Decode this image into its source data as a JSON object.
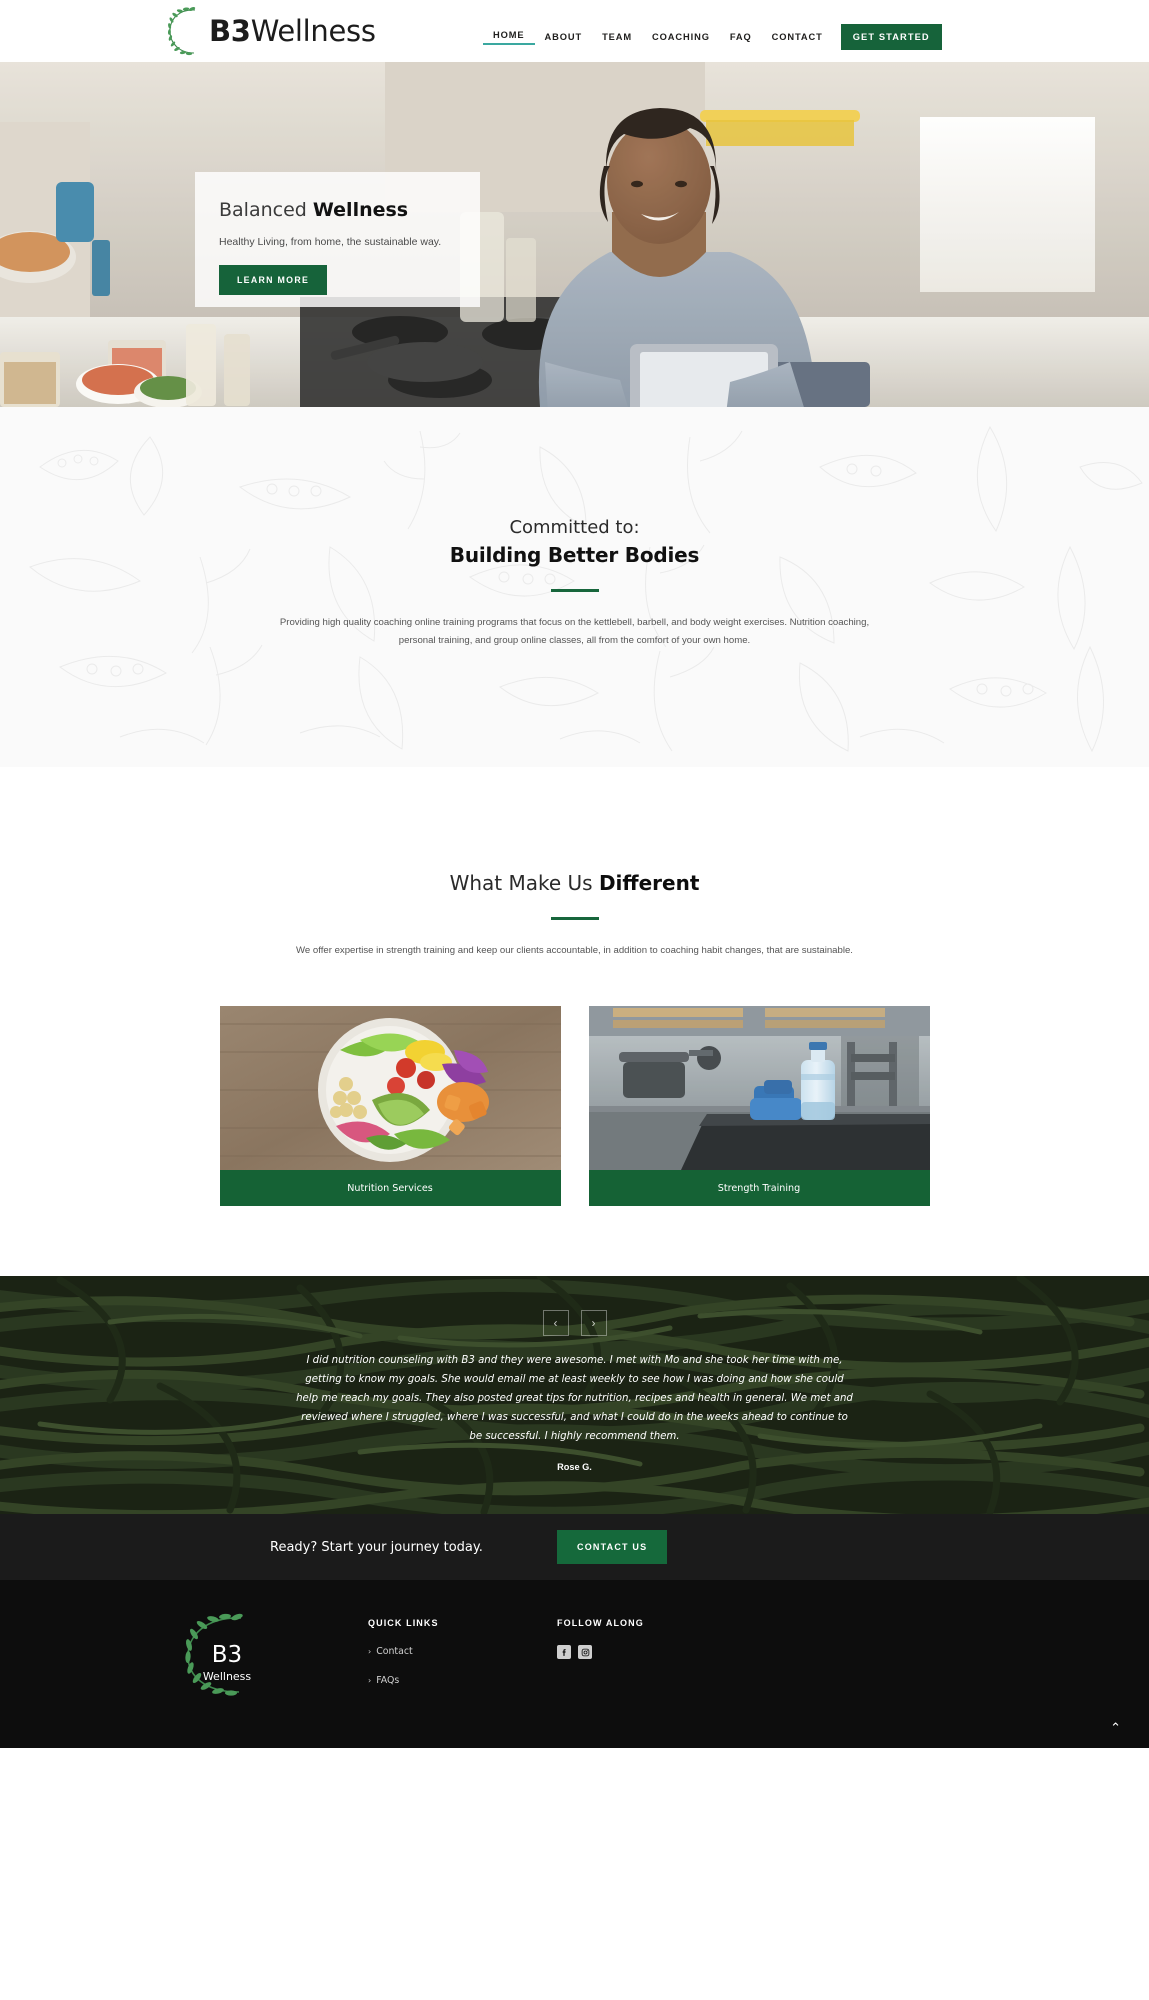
{
  "brand": {
    "name_prefix": "B3",
    "name_suffix": "Wellness",
    "logo_full": "B3 Wellness",
    "accent_green": "#16633a",
    "accent_teal": "#3aa8a0"
  },
  "header": {
    "nav": [
      {
        "label": "HOME",
        "active": true
      },
      {
        "label": "ABOUT",
        "active": false
      },
      {
        "label": "TEAM",
        "active": false
      },
      {
        "label": "COACHING",
        "active": false
      },
      {
        "label": "FAQ",
        "active": false
      },
      {
        "label": "CONTACT",
        "active": false
      }
    ],
    "cta_label": "GET STARTED"
  },
  "hero": {
    "title_light": "Balanced ",
    "title_bold": "Wellness",
    "subtitle": "Healthy Living, from home, the sustainable way.",
    "button_label": "LEARN MORE"
  },
  "committed": {
    "eyebrow": "Committed to:",
    "title": "Building Better Bodies",
    "body": "Providing high quality coaching online training programs that focus on the kettlebell, barbell, and body weight exercises. Nutrition coaching, personal training, and group online classes, all from the comfort of your own home."
  },
  "different": {
    "title_light": "What Make Us ",
    "title_bold": "Different",
    "body": "We offer expertise in strength training and keep our clients accountable, in addition to coaching habit changes, that are sustainable.",
    "cards": [
      {
        "label": "Nutrition Services",
        "image": "salad-bowl-photo"
      },
      {
        "label": "Strength Training",
        "image": "gym-water-bottle-photo"
      }
    ]
  },
  "testimonial": {
    "prev_label": "‹",
    "next_label": "›",
    "quote_open": "“",
    "quote_close": "”",
    "quote": "I did nutrition counseling with B3 and they were awesome.  I met with Mo and she took her time with me, getting to know my goals.  She would email me at least weekly to see how I was doing and how she could help me reach my goals.  They also posted great tips for nutrition, recipes and health in general.  We met and reviewed where I struggled, where I was successful, and what I could do in the weeks ahead to continue to be successful.  I highly recommend them.",
    "author": "Rose G.",
    "background": "green-beans-photo"
  },
  "cta": {
    "text": "Ready? Start your journey today.",
    "button_label": "CONTACT US"
  },
  "footer": {
    "logo_prefix": "B3",
    "logo_suffix": "Wellness",
    "quick_links_heading": "QUICK LINKS",
    "quick_links": [
      {
        "label": "Contact"
      },
      {
        "label": "FAQs"
      }
    ],
    "follow_heading": "FOLLOW ALONG",
    "socials": [
      {
        "name": "facebook"
      },
      {
        "name": "instagram"
      }
    ],
    "scroll_top_glyph": "⌃"
  }
}
